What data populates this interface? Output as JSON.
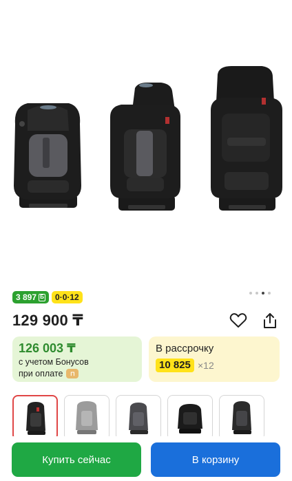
{
  "gallery": {
    "image_description_icon": "car-seat-image",
    "dots_count": 4,
    "active_dot": 2
  },
  "badges": {
    "points": "3 897",
    "installment_tag": "0·0·12"
  },
  "product": {
    "price": "129 900 ₸"
  },
  "bonus_card": {
    "amount": "126 003 ₸",
    "line1": "с учетом Бонусов",
    "line2": "при оплате"
  },
  "installment_card": {
    "title": "В рассрочку",
    "amount": "10 825",
    "times": "×12"
  },
  "actions": {
    "buy_now": "Купить сейчас",
    "add_to_cart": "В корзину"
  },
  "colors": {
    "buy_button": "#1fa844",
    "cart_button": "#1a6fdb",
    "bonus_green": "#2e8b2e",
    "highlight_yellow": "#ffe21a"
  }
}
